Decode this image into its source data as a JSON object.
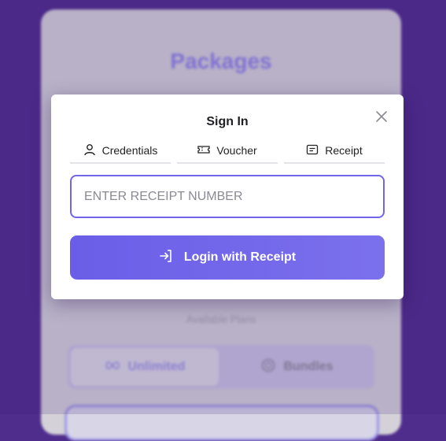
{
  "background": {
    "title": "Packages",
    "subtitle": "Available Plans",
    "tabs": [
      {
        "label": "Unlimited",
        "icon": "infinity-icon"
      },
      {
        "label": "Bundles",
        "icon": "package-icon"
      }
    ]
  },
  "modal": {
    "title": "Sign In",
    "tabs": [
      {
        "label": "Credentials",
        "icon": "user-icon"
      },
      {
        "label": "Voucher",
        "icon": "ticket-icon"
      },
      {
        "label": "Receipt",
        "icon": "receipt-icon"
      }
    ],
    "receipt_input": {
      "placeholder": "ENTER RECEIPT NUMBER",
      "value": ""
    },
    "login_button": {
      "label": "Login with Receipt",
      "icon": "login-icon"
    },
    "close_icon": "close-icon"
  },
  "colors": {
    "page_background": "#4f2d8c",
    "accent": "#6f66e8",
    "button_gradient_start": "#6a5ee8",
    "button_gradient_end": "#7b70ec"
  }
}
